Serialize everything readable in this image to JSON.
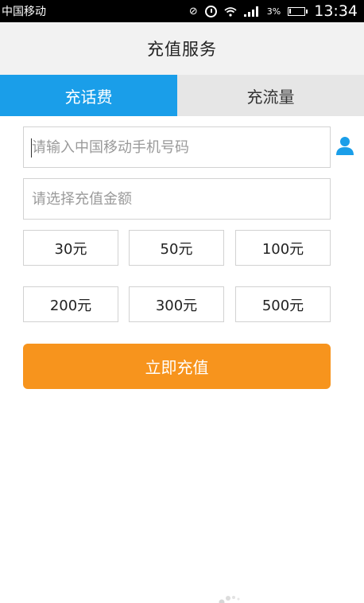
{
  "status_bar": {
    "carrier": "中国移动",
    "battery_percent": "3%",
    "time": "13:34"
  },
  "header": {
    "title": "充值服务"
  },
  "tabs": [
    {
      "label": "充话费",
      "active": true
    },
    {
      "label": "充流量",
      "active": false
    }
  ],
  "form": {
    "phone_placeholder": "请输入中国移动手机号码",
    "amount_placeholder": "请选择充值金额",
    "amounts": [
      "30元",
      "50元",
      "100元",
      "200元",
      "300元",
      "500元"
    ],
    "submit_label": "立即充值"
  },
  "icons": {
    "contact": "person-icon",
    "status": [
      "mute-icon",
      "alarm-icon",
      "wifi-icon",
      "signal-icon",
      "battery-icon"
    ]
  },
  "colors": {
    "accent_blue": "#1a9ee9",
    "submit_orange": "#f7941d",
    "tab_inactive": "#e6e6e6",
    "status_bar": "#000000"
  }
}
